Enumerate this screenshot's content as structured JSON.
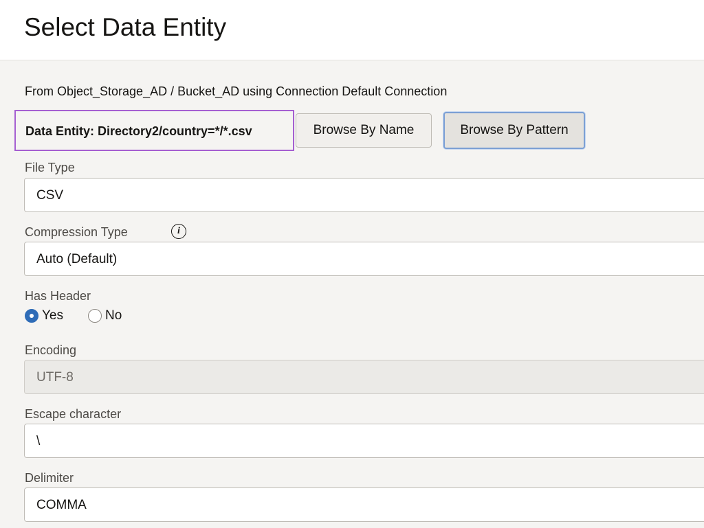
{
  "header": {
    "title": "Select Data Entity"
  },
  "source": {
    "text": "From Object_Storage_AD / Bucket_AD using Connection Default Connection"
  },
  "entity": {
    "label": "Data Entity: Directory2/country=*/*.csv"
  },
  "buttons": {
    "browse_by_name": "Browse By Name",
    "browse_by_pattern": "Browse By Pattern"
  },
  "fields": {
    "file_type": {
      "label": "File Type",
      "value": "CSV"
    },
    "compression_type": {
      "label": "Compression Type",
      "value": "Auto (Default)",
      "info_icon": "info-icon"
    },
    "has_header": {
      "label": "Has Header",
      "options": [
        {
          "label": "Yes",
          "checked": true
        },
        {
          "label": "No",
          "checked": false
        }
      ]
    },
    "encoding": {
      "label": "Encoding",
      "value": "UTF-8",
      "disabled": true
    },
    "escape_character": {
      "label": "Escape character",
      "value": "\\"
    },
    "delimiter": {
      "label": "Delimiter",
      "value": "COMMA"
    }
  },
  "colors": {
    "accent_blue": "#2f6cb7",
    "highlight_purple": "#a55fd1",
    "focus_blue": "#7b9fd4"
  }
}
